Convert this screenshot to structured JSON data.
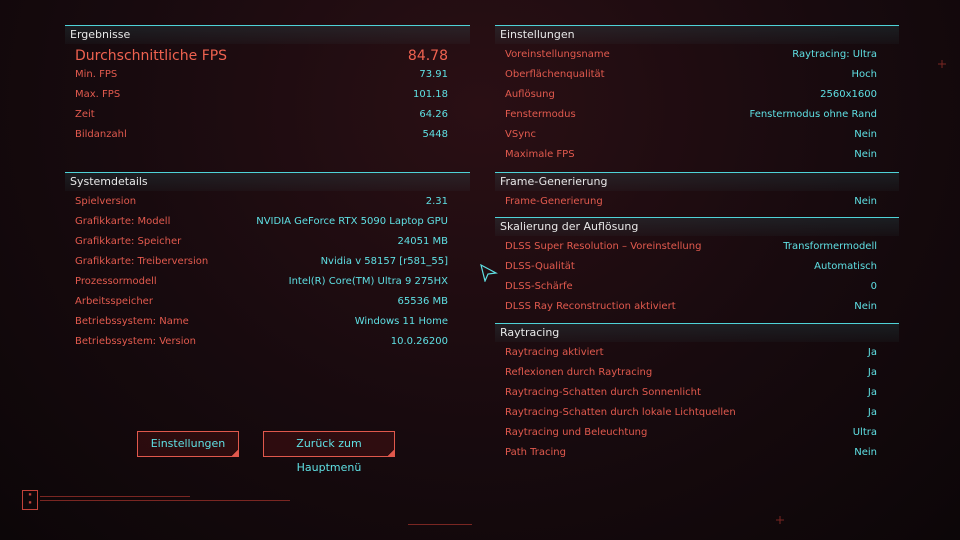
{
  "results": {
    "title": "Ergebnisse",
    "avg": {
      "label": "Durchschnittliche FPS",
      "value": "84.78"
    },
    "rows": [
      {
        "label": "Min. FPS",
        "value": "73.91"
      },
      {
        "label": "Max. FPS",
        "value": "101.18"
      },
      {
        "label": "Zeit",
        "value": "64.26"
      },
      {
        "label": "Bildanzahl",
        "value": "5448"
      }
    ]
  },
  "system": {
    "title": "Systemdetails",
    "rows": [
      {
        "label": "Spielversion",
        "value": "2.31"
      },
      {
        "label": "Grafikkarte: Modell",
        "value": "NVIDIA GeForce RTX 5090 Laptop GPU"
      },
      {
        "label": "Grafikkarte: Speicher",
        "value": "24051 MB"
      },
      {
        "label": "Grafikkarte: Treiberversion",
        "value": "Nvidia v 58157 [r581_55]"
      },
      {
        "label": "Prozessormodell",
        "value": "Intel(R) Core(TM) Ultra 9 275HX"
      },
      {
        "label": "Arbeitsspeicher",
        "value": "65536 MB"
      },
      {
        "label": "Betriebssystem: Name",
        "value": "Windows 11 Home"
      },
      {
        "label": "Betriebssystem: Version",
        "value": "10.0.26200"
      }
    ]
  },
  "settings": {
    "title": "Einstellungen",
    "rows": [
      {
        "label": "Voreinstellungsname",
        "value": "Raytracing: Ultra"
      },
      {
        "label": "Oberflächenqualität",
        "value": "Hoch"
      },
      {
        "label": "Auflösung",
        "value": "2560x1600"
      },
      {
        "label": "Fenstermodus",
        "value": "Fenstermodus ohne Rand"
      },
      {
        "label": "VSync",
        "value": "Nein"
      },
      {
        "label": "Maximale FPS",
        "value": "Nein"
      }
    ]
  },
  "framegen": {
    "title": "Frame-Generierung",
    "rows": [
      {
        "label": "Frame-Generierung",
        "value": "Nein"
      }
    ]
  },
  "scaling": {
    "title": "Skalierung der Auflösung",
    "rows": [
      {
        "label": "DLSS Super Resolution – Voreinstellung",
        "value": "Transformermodell"
      },
      {
        "label": "DLSS-Qualität",
        "value": "Automatisch"
      },
      {
        "label": "DLSS-Schärfe",
        "value": "0"
      },
      {
        "label": "DLSS Ray Reconstruction aktiviert",
        "value": "Nein"
      }
    ]
  },
  "raytracing": {
    "title": "Raytracing",
    "rows": [
      {
        "label": "Raytracing aktiviert",
        "value": "Ja"
      },
      {
        "label": "Reflexionen durch Raytracing",
        "value": "Ja"
      },
      {
        "label": "Raytracing-Schatten durch Sonnenlicht",
        "value": "Ja"
      },
      {
        "label": "Raytracing-Schatten durch lokale Lichtquellen",
        "value": "Ja"
      },
      {
        "label": "Raytracing und Beleuchtung",
        "value": "Ultra"
      },
      {
        "label": "Path Tracing",
        "value": "Nein"
      }
    ]
  },
  "buttons": {
    "settings": "Einstellungen",
    "main_menu": "Zurück zum Hauptmenü"
  },
  "colors": {
    "accent_cyan": "#5fe0e4",
    "accent_red": "#e25a4e"
  }
}
